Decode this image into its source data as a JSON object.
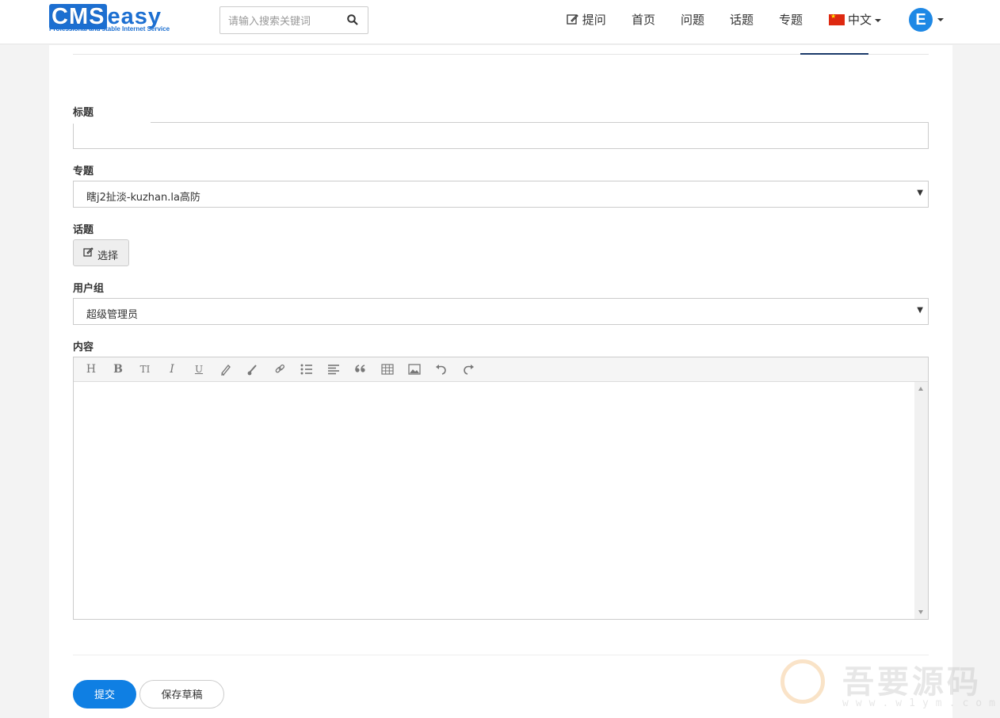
{
  "header": {
    "logo_main_cms": "CMS",
    "logo_main_easy": "easy",
    "logo_sub": "Professional and stable Internet Service",
    "search_placeholder": "请输入搜索关键词",
    "nav": {
      "ask": "提问",
      "home": "首页",
      "questions": "问题",
      "topics": "话题",
      "subjects": "专题",
      "language": "中文"
    },
    "avatar_letter": "E"
  },
  "form": {
    "title_label": "标题",
    "subject_label": "专题",
    "subject_value": "瞎j2扯淡-kuzhan.la高防",
    "topic_label": "话题",
    "choose_button": "选择",
    "usergroup_label": "用户组",
    "usergroup_value": "超级管理员",
    "content_label": "内容",
    "toolbar": [
      "H",
      "B",
      "TI",
      "I",
      "U",
      "brush-icon",
      "paint-icon",
      "link-icon",
      "list-icon",
      "align-icon",
      "quote-icon",
      "table-icon",
      "image-icon",
      "undo-icon",
      "redo-icon"
    ],
    "submit_button": "提交",
    "draft_button": "保存草稿"
  },
  "watermark": {
    "text": "吾要源码",
    "url": "www.w1ym.com"
  },
  "colors": {
    "primary": "#0f7fe3",
    "logo": "#1c6fd1"
  }
}
